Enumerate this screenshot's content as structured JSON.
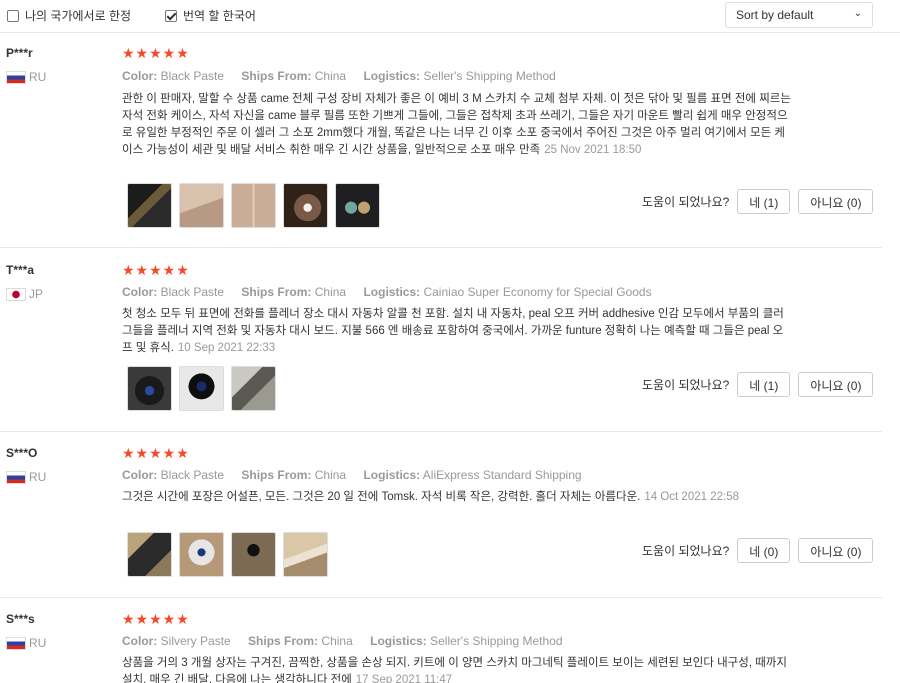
{
  "filters": {
    "local_only_label": "나의 국가에서로 한정",
    "local_only_checked": false,
    "translate_label": "번역 할 한국어",
    "translate_checked": true,
    "sort_selected": "Sort by default"
  },
  "labels": {
    "color": "Color:",
    "ships_from": "Ships From:",
    "logistics": "Logistics:",
    "helpful": "도움이 되었나요?"
  },
  "colors": {
    "star": "#f44a2a",
    "muted": "#999999",
    "text": "#333333"
  },
  "reviews": [
    {
      "name": "P***r",
      "country": "RU",
      "stars": "★★★★★",
      "color": "Black Paste",
      "ships_from": "China",
      "logistics": "Seller's Shipping Method",
      "text": "관한 이 판매자, 말할 수 상품 came 전체 구성 장비 자체가 좋은 이 예비 3 M 스카치 수 교체 첨부 자체. 이 젓은 닦아 및 필름 표면 전에 찌르는 자석 전화 케이스, 자석 자신을 came 블루 필름 또한 기쁘게 그들에, 그들은 접착제 초과 쓰레기, 그들은 자기 마운트 빨리 쉽게 매우 안정적으로 유일한 부정적인 주문 이 셀러 그 소포 2mm했다 개월, 똑같은 나는 너무 긴 이후 소포 중국에서 주어진 그것은 아주 멀리 여기에서 모든 케이스 가능성이 세관 및 배달 서비스 취한 매우 긴 시간 상품을, 일반적으로 소포 매우 만족",
      "date": "25 Nov 2021 18:50",
      "yes": "네 (1)",
      "no": "아니요 (0)"
    },
    {
      "name": "T***a",
      "country": "JP",
      "stars": "★★★★★",
      "color": "Black Paste",
      "ships_from": "China",
      "logistics": "Cainiao Super Economy for Special Goods",
      "text": "첫 청소 모두 뒤 표면에 전화를 플레너 장소 대시 자동차 알콜 천 포함. 설치 내 자동차, peal 오프 커버 addhesive 인감 모두에서 부품의 클러 그들을 플레너 지역 전화 및 자동차 대시 보드. 지불 566 엔 배송료 포함하여 중국에서. 가까운 funture 정확히 나는 예측할 때 그들은 peal 오프 및 휴식.",
      "date": "10 Sep 2021 22:33",
      "yes": "네 (1)",
      "no": "아니요 (0)"
    },
    {
      "name": "S***O",
      "country": "RU",
      "stars": "★★★★★",
      "color": "Black Paste",
      "ships_from": "China",
      "logistics": "AliExpress Standard Shipping",
      "text": "그것은 시간에 포장은 어설픈, 모든. 그것은 20 일 전에 Tomsk. 자석 비록 작은, 강력한. 홀더 자체는 아름다운.",
      "date": "14 Oct 2021 22:58",
      "yes": "네 (0)",
      "no": "아니요 (0)"
    },
    {
      "name": "S***s",
      "country": "RU",
      "stars": "★★★★★",
      "color": "Silvery Paste",
      "ships_from": "China",
      "logistics": "Seller's Shipping Method",
      "text": "상품을 거의 3 개월 상자는 구겨진, 끔찍한, 상품을 손상 되지. 키트에 이 양면 스카치 마그네틱 플레이트 보이는 세련된 보인다 내구성, 때까지 설치, 매우 긴 배달, 다음에 나는 생각하니다 전에",
      "date": "17 Sep 2021 11:47"
    }
  ]
}
